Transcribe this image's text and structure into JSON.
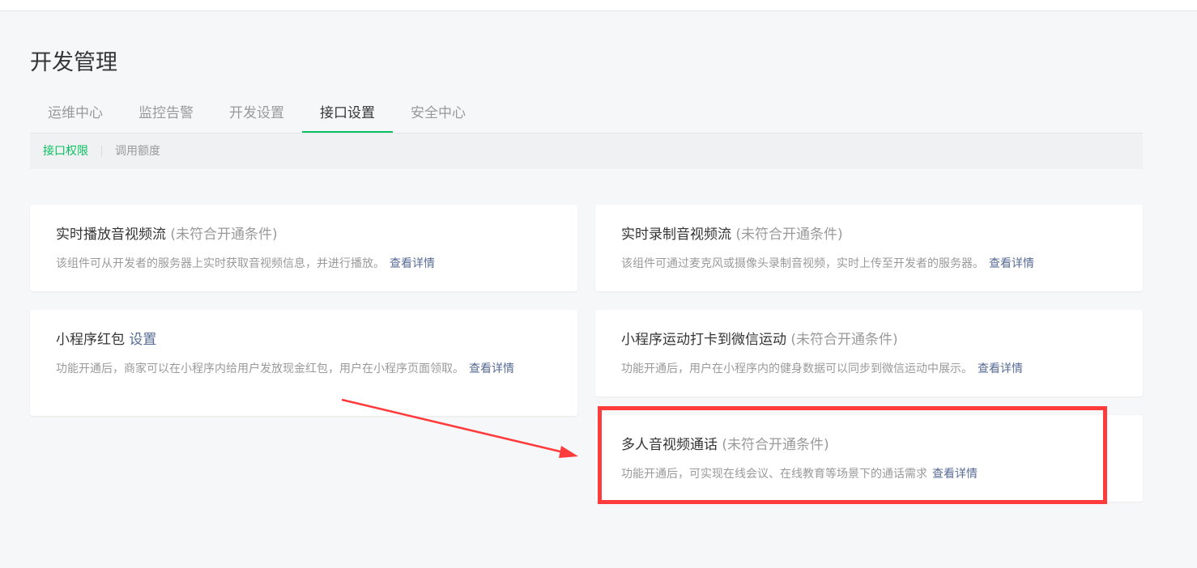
{
  "page": {
    "title": "开发管理"
  },
  "tabs": [
    {
      "label": "运维中心"
    },
    {
      "label": "监控告警"
    },
    {
      "label": "开发设置"
    },
    {
      "label": "接口设置"
    },
    {
      "label": "安全中心"
    }
  ],
  "subnav": [
    {
      "label": "接口权限"
    },
    {
      "label": "调用额度"
    }
  ],
  "cards": [
    {
      "title": "实时播放音视频流",
      "status": "(未符合开通条件)",
      "desc": "该组件可从开发者的服务器上实时获取音视频信息，并进行播放。",
      "link": "查看详情"
    },
    {
      "title": "实时录制音视频流",
      "status": "(未符合开通条件)",
      "desc": "该组件可通过麦克风或摄像头录制音视频，实时上传至开发者的服务器。",
      "link": "查看详情"
    },
    {
      "title": "小程序红包",
      "setting": "设置",
      "desc": "功能开通后，商家可以在小程序内给用户发放现金红包，用户在小程序页面领取。",
      "link": "查看详情"
    },
    {
      "title": "小程序运动打卡到微信运动",
      "status": "(未符合开通条件)",
      "desc": "功能开通后，用户在小程序内的健身数据可以同步到微信运动中展示。",
      "link": "查看详情"
    },
    {
      "title": "多人音视频通话",
      "status": "(未符合开通条件)",
      "desc": "功能开通后，可实现在线会议、在线教育等场景下的通话需求",
      "link": "查看详情"
    }
  ],
  "colors": {
    "accent": "#07c160",
    "link": "#576b95",
    "annotation": "#ff3b3b"
  }
}
